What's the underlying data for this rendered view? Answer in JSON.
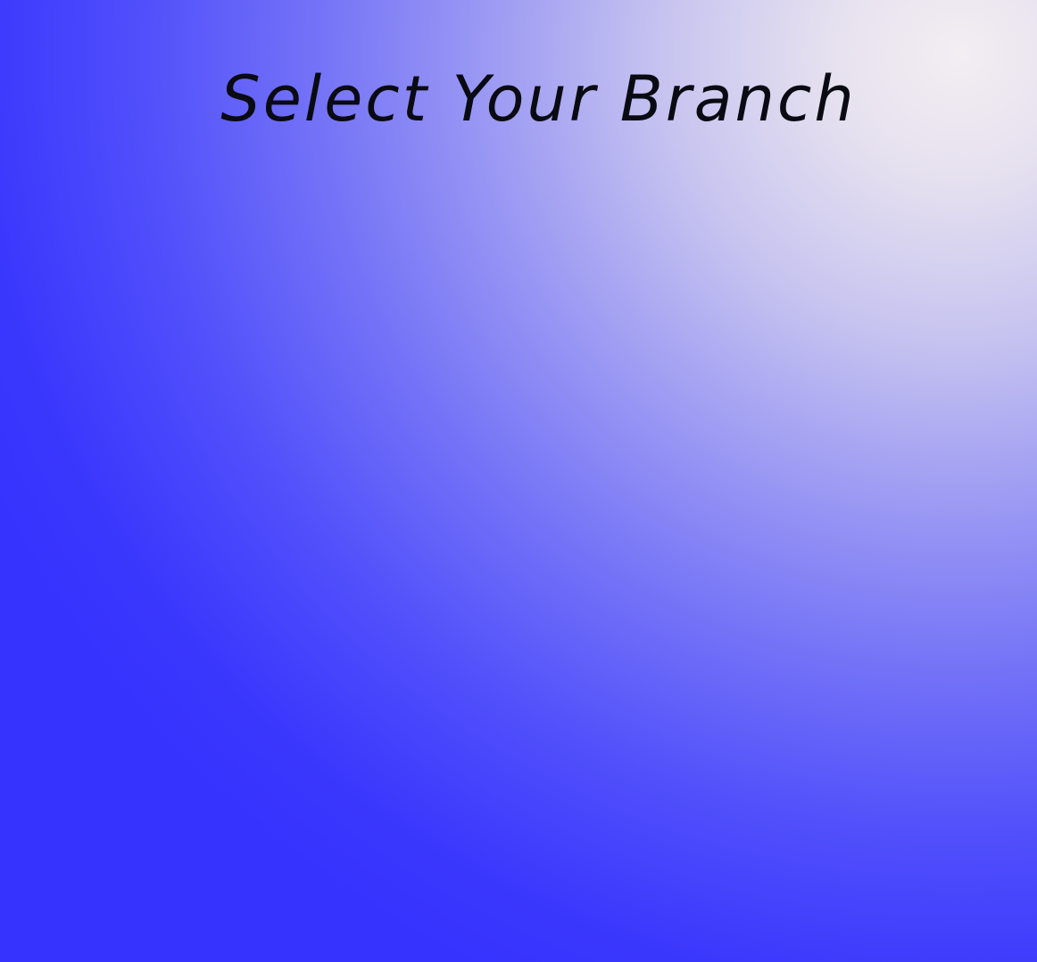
{
  "page": {
    "title": "Select Your Branch"
  },
  "colors": {
    "background_primary": "#3633fe",
    "background_highlight": "#f3eef2",
    "title_text": "#0a0a12"
  }
}
